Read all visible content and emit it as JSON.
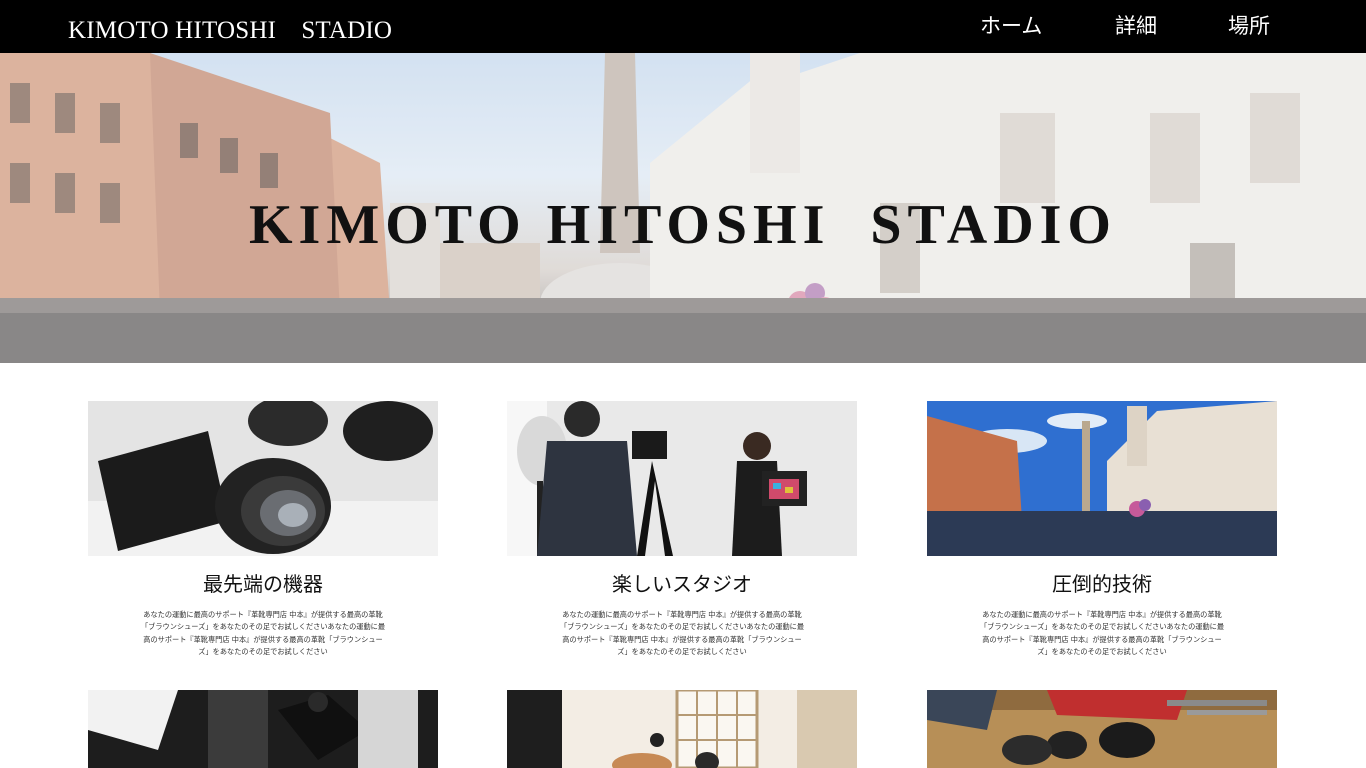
{
  "header": {
    "brand": "KIMOTO HITOSHI　STADIO",
    "nav": [
      "ホーム",
      "詳細",
      "場所"
    ]
  },
  "hero": {
    "title": "KIMOTO HITOSHI  STADIO"
  },
  "features": [
    {
      "title": "最先端の機器",
      "text": "あなたの運動に最高のサポート『革靴専門店 中本』が提供する最高の革靴「ブラウンシューズ」をあなたのその足でお試しくださいあなたの運動に最高のサポート『革靴専門店 中本』が提供する最高の革靴「ブラウンシューズ」をあなたのその足でお試しください"
    },
    {
      "title": "楽しいスタジオ",
      "text": "あなたの運動に最高のサポート『革靴専門店 中本』が提供する最高の革靴「ブラウンシューズ」をあなたのその足でお試しくださいあなたの運動に最高のサポート『革靴専門店 中本』が提供する最高の革靴「ブラウンシューズ」をあなたのその足でお試しください"
    },
    {
      "title": "圧倒的技術",
      "text": "あなたの運動に最高のサポート『革靴専門店 中本』が提供する最高の革靴「ブラウンシューズ」をあなたのその足でお試しくださいあなたの運動に最高のサポート『革靴専門店 中本』が提供する最高の革靴「ブラウンシューズ」をあなたのその足でお試しください"
    }
  ],
  "colors": {
    "header_bg": "#000000",
    "header_text": "#ffffff",
    "page_bg": "#ffffff"
  }
}
